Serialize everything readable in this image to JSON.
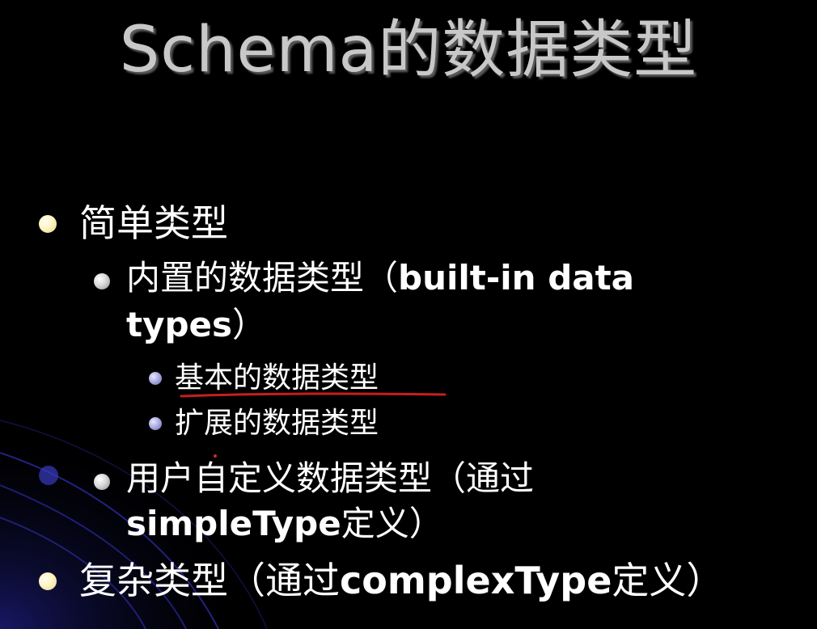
{
  "slide": {
    "title": "Schema的数据类型",
    "items": [
      {
        "level": 1,
        "text": "简单类型"
      },
      {
        "level": 2,
        "text_cn": "内置的数据类型（",
        "text_en": "built-in data",
        "text_line2_en": "types",
        "text_line2_close": "）"
      },
      {
        "level": 3,
        "text": "基本的数据类型"
      },
      {
        "level": 3,
        "text": "扩展的数据类型"
      },
      {
        "level": 2,
        "text": "用户自定义数据类型（通过",
        "text_line2_en": "simpleType",
        "text_line2_cn": "定义）"
      },
      {
        "level": 1,
        "text_cn": "复杂类型（通过",
        "text_en": "complexType",
        "text_cn_end": "定义）"
      }
    ]
  },
  "colors": {
    "background": "#000000",
    "title": "#c8c8c8",
    "text": "#ffffff",
    "annotation": "#c81e1e",
    "decor": "#2a2aa0"
  }
}
